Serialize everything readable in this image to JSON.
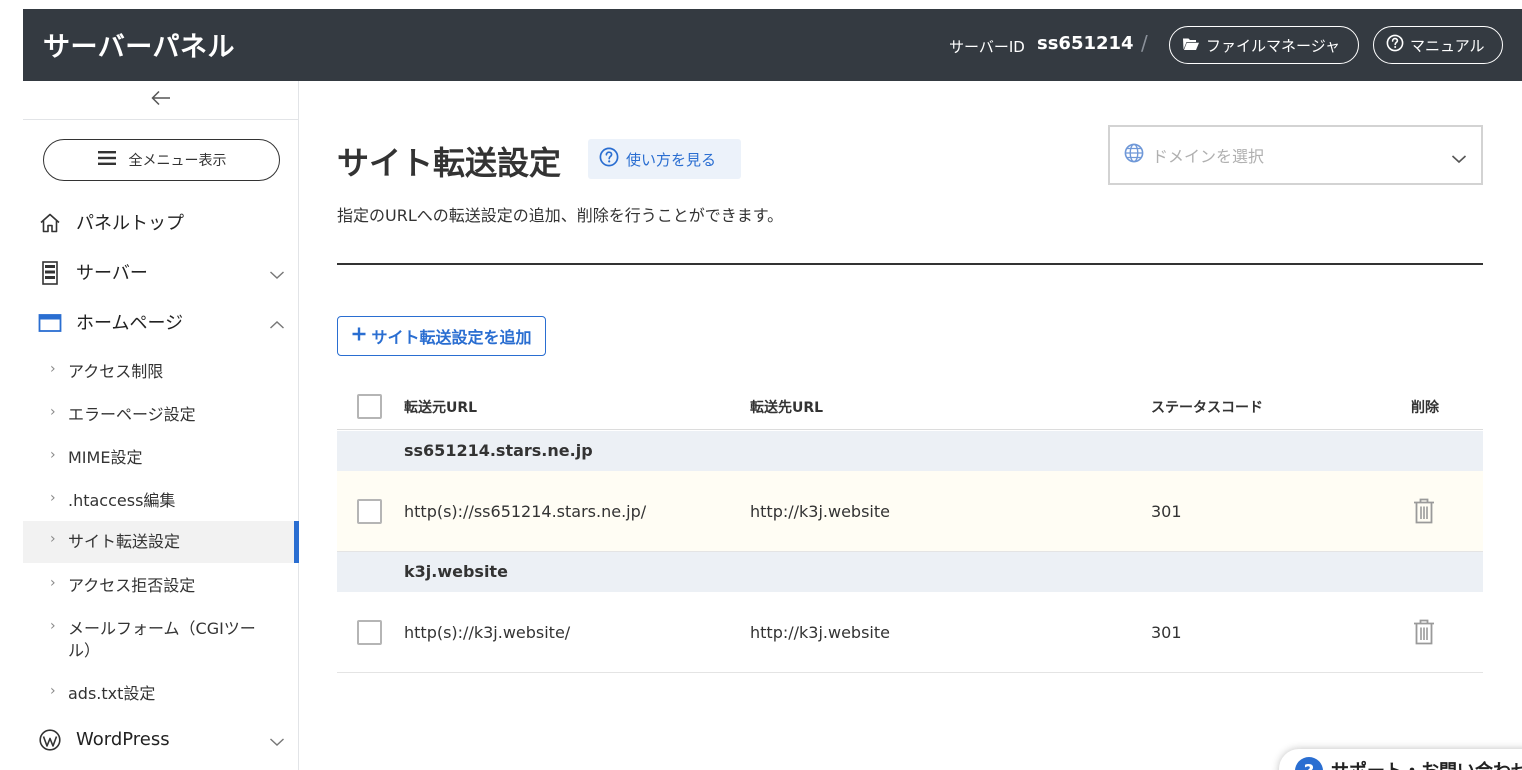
{
  "header": {
    "brand": "サーバーパネル",
    "server_id_label": "サーバーID",
    "server_id_value": "ss651214",
    "separator": "/",
    "file_manager_label": "ファイルマネージャ",
    "manual_label": "マニュアル"
  },
  "sidebar": {
    "all_menu_label": "全メニュー表示",
    "top_items": [
      {
        "label": "パネルトップ",
        "icon": "home-icon"
      },
      {
        "label": "サーバー",
        "icon": "server-icon"
      },
      {
        "label": "ホームページ",
        "icon": "browser-window-icon"
      },
      {
        "label": "WordPress",
        "icon": "wordpress-icon"
      }
    ],
    "sub_items": [
      {
        "label": "アクセス制限"
      },
      {
        "label": "エラーページ設定"
      },
      {
        "label": "MIME設定"
      },
      {
        "label": ".htaccess編集"
      },
      {
        "label": "サイト転送設定",
        "active": true
      },
      {
        "label": "アクセス拒否設定"
      },
      {
        "label": "メールフォーム（CGIツール）"
      },
      {
        "label": "ads.txt設定"
      }
    ]
  },
  "main": {
    "title": "サイト転送設定",
    "howto_label": "使い方を見る",
    "domain_placeholder": "ドメインを選択",
    "description": "指定のURLへの転送設定の追加、削除を行うことができます。",
    "add_button_label": "サイト転送設定を追加",
    "table": {
      "headers": {
        "source": "転送元URL",
        "destination": "転送先URL",
        "status": "ステータスコード",
        "delete": "削除"
      },
      "groups": [
        {
          "domain": "ss651214.stars.ne.jp",
          "rows": [
            {
              "source": "http(s)://ss651214.stars.ne.jp/",
              "destination": "http://k3j.website",
              "status": "301"
            }
          ]
        },
        {
          "domain": "k3j.website",
          "rows": [
            {
              "source": "http(s)://k3j.website/",
              "destination": "http://k3j.website",
              "status": "301"
            }
          ]
        }
      ]
    }
  },
  "support": {
    "label": "サポート・お問い合わせ",
    "icon_glyph": "?"
  },
  "colors": {
    "header_bg": "#343a41",
    "accent": "#2a6ed1",
    "group_bg": "#ecf0f5"
  }
}
